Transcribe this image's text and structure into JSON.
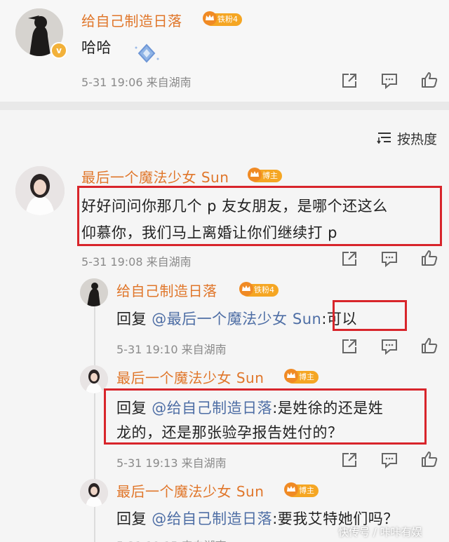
{
  "top_comment": {
    "username": "给自己制造日落",
    "badge": "铁粉4",
    "text": "哈哈",
    "meta": "5-31 19:06  来自湖南"
  },
  "sort": {
    "label": "按热度"
  },
  "main_comment": {
    "username": "最后一个魔法少女 Sun",
    "badge": "博主",
    "text_line1": "好好问问你那几个 p 友女朋友，是哪个还这么",
    "text_line2": "仰慕你，我们马上离婚让你们继续打 p",
    "meta": "5-31 19:08  来自湖南"
  },
  "replies": [
    {
      "username": "给自己制造日落",
      "badge": "铁粉4",
      "prefix": "回复 ",
      "mention": "@最后一个魔法少女 Sun",
      "text": ":可以",
      "meta": "5-31 19:10  来自湖南"
    },
    {
      "username": "最后一个魔法少女 Sun",
      "badge": "博主",
      "prefix": "回复 ",
      "mention": "@给自己制造日落",
      "text": ":是姓徐的还是姓",
      "text_line2": "龙的，还是那张验孕报告姓付的？",
      "meta": "5-31 19:13  来自湖南"
    },
    {
      "username": "最后一个魔法少女 Sun",
      "badge": "博主",
      "prefix": "回复 ",
      "mention": "@给自己制造日落",
      "text": ":要我艾特她们吗？"
    }
  ],
  "watermark": "快传号 / 咔咔有娱",
  "colors": {
    "username": "#e0762a",
    "mention": "#4e6ea5",
    "highlight_box": "#d8252b"
  }
}
